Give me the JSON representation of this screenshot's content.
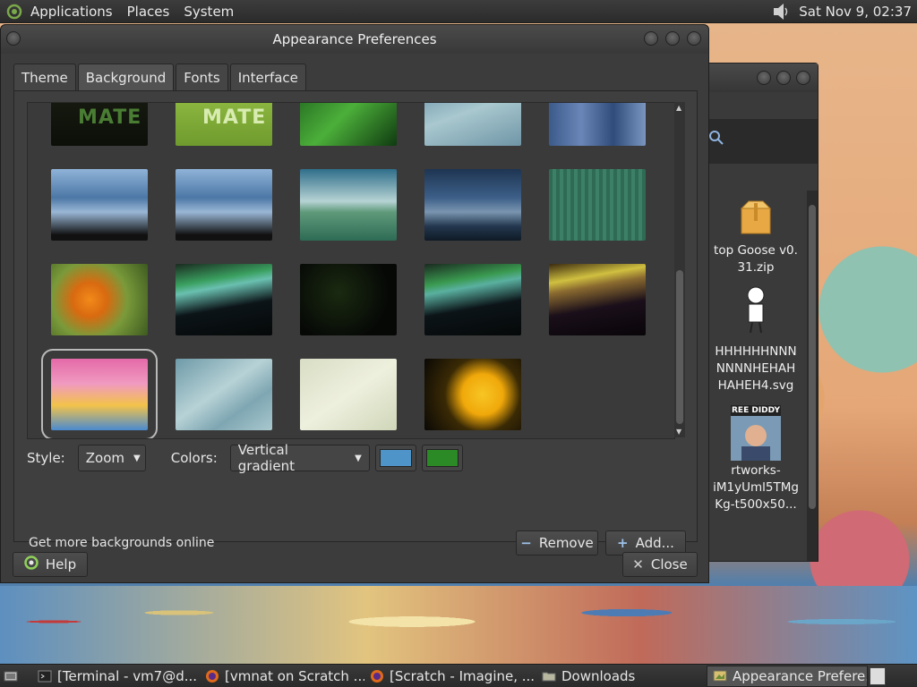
{
  "top_panel": {
    "menus": [
      "Applications",
      "Places",
      "System"
    ],
    "clock": "Sat Nov 9, 02:37"
  },
  "window": {
    "title": "Appearance Preferences",
    "tabs": [
      {
        "label": "Theme",
        "active": false
      },
      {
        "label": "Background",
        "active": true
      },
      {
        "label": "Fonts",
        "active": false
      },
      {
        "label": "Interface",
        "active": false
      }
    ],
    "mate_text": "MATE",
    "style_label": "Style:",
    "style_value": "Zoom",
    "colors_label": "Colors:",
    "colors_value": "Vertical gradient",
    "color1": "#4f94c8",
    "color2": "#2b8a26",
    "online_link": "Get more backgrounds online",
    "remove_label": "Remove",
    "add_label": "Add...",
    "help_label": "Help",
    "close_label": "Close"
  },
  "file_window": {
    "files": [
      {
        "name_line1": "top Goose v0.",
        "name_line2": "31.zip"
      },
      {
        "name_line1": "HHHHHHNNN",
        "name_line2": "NNNNHEHAH",
        "name_line3": "HAHEH4.svg"
      },
      {
        "badge": "REE DIDDY",
        "name_line1": "rtworks-",
        "name_line2": "iM1yUml5TMg",
        "name_line3": "Kg-t500x50..."
      }
    ]
  },
  "taskbar": {
    "items": [
      {
        "label": "[Terminal - vm7@d...",
        "icon": "terminal-icon",
        "active": false
      },
      {
        "label": "[vmnat on Scratch ...",
        "icon": "firefox-icon",
        "active": false
      },
      {
        "label": "[Scratch - Imagine, ...",
        "icon": "firefox-icon",
        "active": false
      },
      {
        "label": "Downloads",
        "icon": "folder-icon",
        "active": false
      },
      {
        "label": "Appearance Prefere...",
        "icon": "appearance-icon",
        "active": true
      }
    ]
  },
  "colors": {
    "panel": "#2b2b2b",
    "window_bg": "#3c3c3c",
    "selection_outline": "#b9b9b9"
  }
}
